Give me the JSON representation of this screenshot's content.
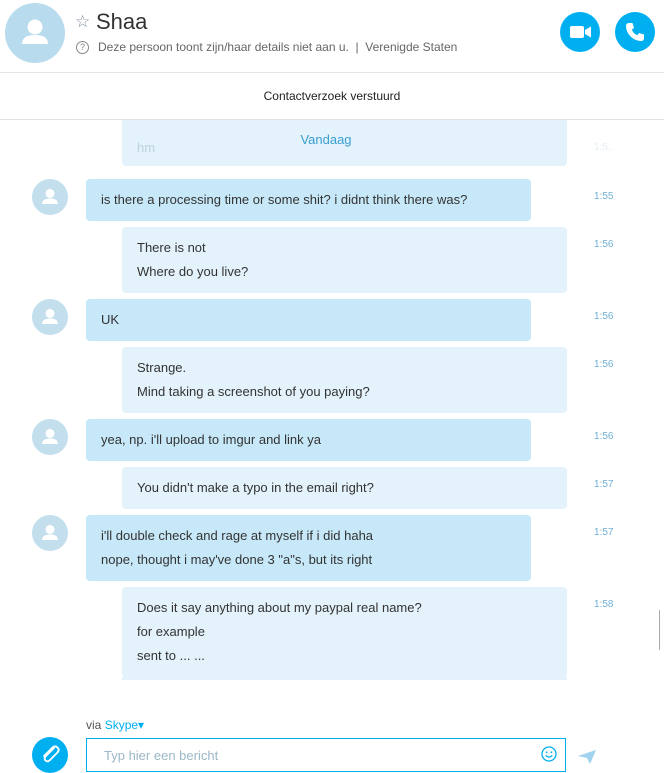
{
  "header": {
    "contact_name": "Shaa",
    "status_text": "Deze persoon toont zijn/haar details niet aan u.  |  Verenigde Staten",
    "help_glyph": "?",
    "star_glyph": "☆",
    "icons": [
      "avatar-icon",
      "star-icon",
      "help-icon",
      "video-call-icon",
      "phone-call-icon"
    ]
  },
  "request_bar": {
    "text": "Contactverzoek verstuurd"
  },
  "chat": {
    "date_separator": "Vandaag",
    "partial_top": {
      "text": "hm",
      "time": "1:5.."
    },
    "messages": [
      {
        "direction": "in",
        "lines": [
          "is there a processing time or some shit? i didnt think there was?"
        ],
        "time": "1:55"
      },
      {
        "direction": "out",
        "lines": [
          "There is not",
          "Where do you live?"
        ],
        "time": "1:56"
      },
      {
        "direction": "in",
        "lines": [
          "UK"
        ],
        "time": "1:56"
      },
      {
        "direction": "out",
        "lines": [
          "Strange.",
          "Mind taking a screenshot of you paying?"
        ],
        "time": "1:56"
      },
      {
        "direction": "in",
        "lines": [
          "yea, np. i'll upload to imgur and link ya"
        ],
        "time": "1:56"
      },
      {
        "direction": "out",
        "lines": [
          "You didn't make a typo in the email right?"
        ],
        "time": "1:57"
      },
      {
        "direction": "in",
        "lines": [
          "i'll double check and rage at myself if i did haha",
          "nope, thought i may've done 3 \"a\"s, but its right"
        ],
        "time": "1:57"
      },
      {
        "direction": "out",
        "lines": [
          "Does it say anything about my paypal real name?",
          "for example",
          "sent to ... ..."
        ],
        "time": "1:58"
      }
    ]
  },
  "composer": {
    "via_prefix": "via",
    "via_service": "Skype",
    "via_caret": "▾",
    "placeholder": "Typ hier een bericht",
    "value": ""
  },
  "colors": {
    "accent": "#00aff0",
    "incoming_bubble": "#c7e8f8",
    "outgoing_bubble": "#e3f2fb",
    "timestamp": "#6fb1d6",
    "date_separator": "#3a9ed3"
  }
}
